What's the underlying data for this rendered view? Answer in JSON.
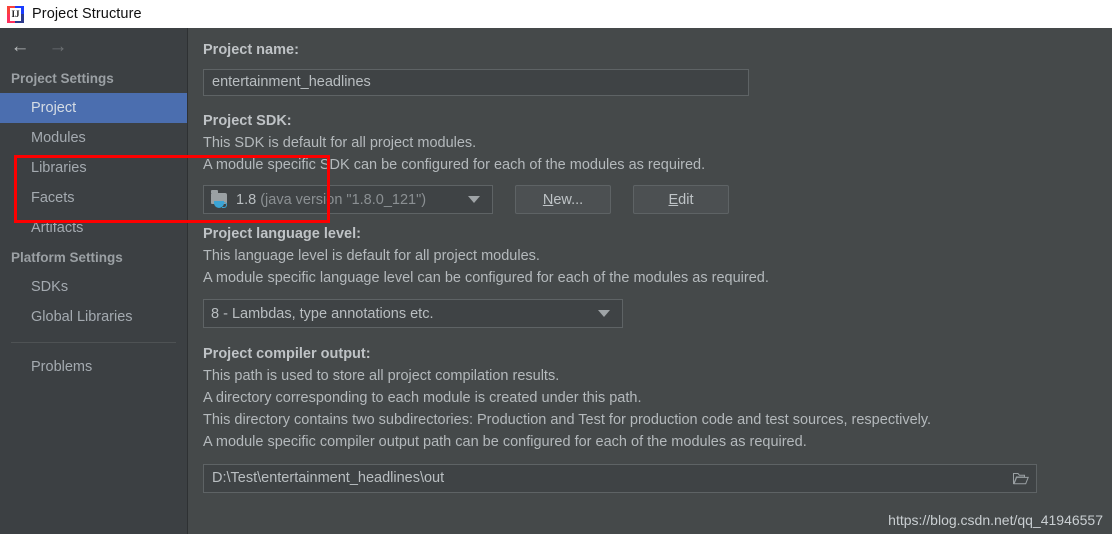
{
  "window": {
    "title": "Project Structure",
    "app_icon": "intellij-idea-logo"
  },
  "sidebar": {
    "nav": {
      "back_icon": "arrow-left-icon",
      "forward_icon": "arrow-right-icon"
    },
    "groups": [
      {
        "header": "Project Settings",
        "items": [
          {
            "label": "Project",
            "selected": true
          },
          {
            "label": "Modules",
            "selected": false
          },
          {
            "label": "Libraries",
            "selected": false
          },
          {
            "label": "Facets",
            "selected": false
          },
          {
            "label": "Artifacts",
            "selected": false
          }
        ]
      },
      {
        "header": "Platform Settings",
        "items": [
          {
            "label": "SDKs",
            "selected": false
          },
          {
            "label": "Global Libraries",
            "selected": false
          }
        ]
      }
    ],
    "footer_items": [
      {
        "label": "Problems",
        "selected": false
      }
    ]
  },
  "main": {
    "project_name": {
      "label": "Project name:",
      "value": "entertainment_headlines"
    },
    "project_sdk": {
      "label": "Project SDK:",
      "desc_1": "This SDK is default for all project modules.",
      "desc_2": "A module specific SDK can be configured for each of the modules as required.",
      "combo_icon": "java-sdk-folder-icon",
      "combo_value_main": "1.8",
      "combo_value_detail": "(java version \"1.8.0_121\")",
      "new_button": "New...",
      "new_button_mnemonic": "N",
      "new_button_rest": "ew...",
      "edit_button": "Edit",
      "edit_button_mnemonic": "E",
      "edit_button_rest": "dit"
    },
    "language_level": {
      "label": "Project language level:",
      "desc_1": "This language level is default for all project modules.",
      "desc_2": "A module specific language level can be configured for each of the modules as required.",
      "combo_value": "8 - Lambdas, type annotations etc."
    },
    "compiler_output": {
      "label": "Project compiler output:",
      "desc_1": "This path is used to store all project compilation results.",
      "desc_2": "A directory corresponding to each module is created under this path.",
      "desc_3": "This directory contains two subdirectories: Production and Test for production code and test sources, respectively.",
      "desc_4": "A module specific compiler output path can be configured for each of the modules as required.",
      "value": "D:\\Test\\entertainment_headlines\\out",
      "browse_icon": "folder-open-icon"
    }
  },
  "annotation": {
    "highlight_color": "#fd0000"
  },
  "watermark": {
    "text": "https://blog.csdn.net/qq_41946557"
  }
}
